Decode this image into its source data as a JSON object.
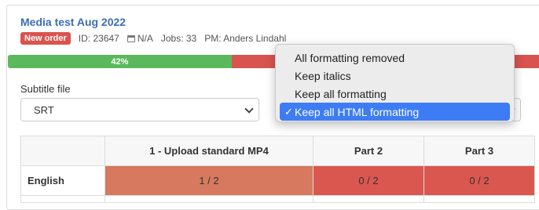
{
  "project": {
    "title": "Media test Aug 2022",
    "badge": "New order",
    "id": "ID: 23647",
    "date": "N/A",
    "jobs": "Jobs: 33",
    "pm": "PM: Anders Lindahl"
  },
  "progress": {
    "label": "42%",
    "value": 0.42,
    "fill_color": "#5cb85c",
    "rest_color": "#d9534f"
  },
  "subtitle": {
    "label": "Subtitle file",
    "selected": "SRT"
  },
  "formatting_menu": {
    "items": [
      {
        "label": "All formatting removed",
        "selected": false
      },
      {
        "label": "Keep italics",
        "selected": false
      },
      {
        "label": "Keep all formatting",
        "selected": false
      },
      {
        "label": "Keep all HTML formatting",
        "selected": true
      }
    ],
    "check_mark": "✓"
  },
  "table": {
    "headers": [
      "",
      "1 - Upload standard MP4",
      "Part 2",
      "Part 3"
    ],
    "rows": [
      {
        "language": "English",
        "cells": [
          "1 / 2",
          "0 / 2",
          "0 / 2"
        ]
      }
    ],
    "colors": {
      "partial": "#d6795e",
      "none": "#d9574f"
    }
  }
}
